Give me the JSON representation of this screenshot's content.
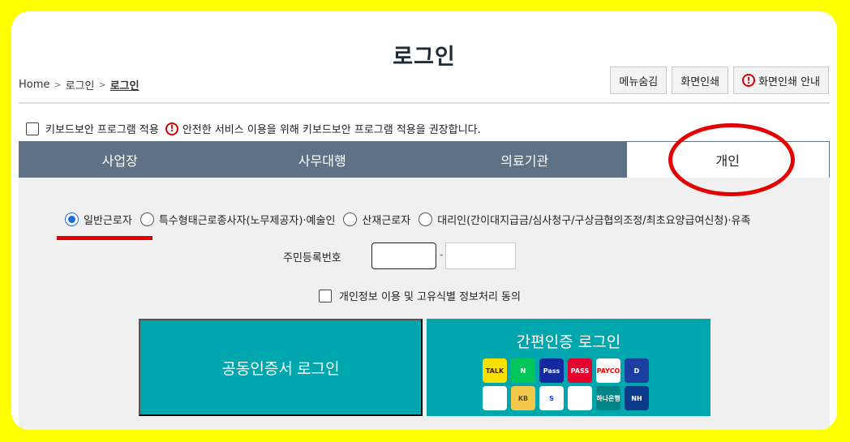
{
  "page": {
    "title": "로그인"
  },
  "breadcrumb": {
    "home": "Home",
    "item1": "로그인",
    "item2": "로그인"
  },
  "top_buttons": {
    "hide_menu": "메뉴숨김",
    "print": "화면인쇄",
    "print_guide": "화면인쇄 안내"
  },
  "keyboard_security": {
    "label": "키보드보안 프로그램 적용",
    "notice": "안전한 서비스 이용을 위해 키보드보안 프로그램 적용을 권장합니다."
  },
  "tabs": [
    {
      "label": "사업장"
    },
    {
      "label": "사무대행"
    },
    {
      "label": "의료기관"
    },
    {
      "label": "개인"
    }
  ],
  "user_types": [
    {
      "label": "일반근로자",
      "checked": true
    },
    {
      "label": "특수형태근로종사자(노무제공자)·예술인",
      "checked": false
    },
    {
      "label": "산재근로자",
      "checked": false
    },
    {
      "label": "대리인(간이대지급금/심사청구/구상금협의조정/최초요양급여신청)·유족",
      "checked": false
    }
  ],
  "ssn": {
    "label": "주민등록번호",
    "separator": "-",
    "front_value": "",
    "back_value": ""
  },
  "consent": {
    "label": "개인정보 이용 및 고유식별 정보처리 동의"
  },
  "login_buttons": {
    "certificate": "공동인증서 로그인",
    "simple_auth": "간편인증 로그인"
  },
  "auth_logos": [
    {
      "name": "kakao-talk",
      "text": "TALK",
      "bg": "#f9e000",
      "fg": "#3c1e1e"
    },
    {
      "name": "naver",
      "text": "N",
      "bg": "#03c75a",
      "fg": "#ffffff"
    },
    {
      "name": "samsung-pass",
      "text": "Pass",
      "bg": "#1428a0",
      "fg": "#ffffff"
    },
    {
      "name": "pass",
      "text": "PASS",
      "bg": "#e6002d",
      "fg": "#ffffff"
    },
    {
      "name": "payco",
      "text": "PAYCO",
      "bg": "#ffffff",
      "fg": "#ff0000"
    },
    {
      "name": "d-shield",
      "text": "D",
      "bg": "#1b3fa0",
      "fg": "#ffffff"
    },
    {
      "name": "toss",
      "text": "",
      "bg": "#ffffff",
      "fg": "#0064ff"
    },
    {
      "name": "kb",
      "text": "KB",
      "bg": "#f2c94c",
      "fg": "#5c4a1e"
    },
    {
      "name": "shinhan",
      "text": "S",
      "bg": "#ffffff",
      "fg": "#0046ff"
    },
    {
      "name": "woori",
      "text": "",
      "bg": "#ffffff",
      "fg": "#16b6a0"
    },
    {
      "name": "hana",
      "text": "하나은행",
      "bg": "#008485",
      "fg": "#ffffff"
    },
    {
      "name": "nh",
      "text": "NH",
      "bg": "#0b3a8c",
      "fg": "#ffffff"
    }
  ],
  "colors": {
    "tab_bg": "#5f7184",
    "primary_button": "#00a6ad",
    "radio_selected": "#1a6fd6",
    "annotation": "#e40000",
    "frame_bg": "#ffff00"
  }
}
